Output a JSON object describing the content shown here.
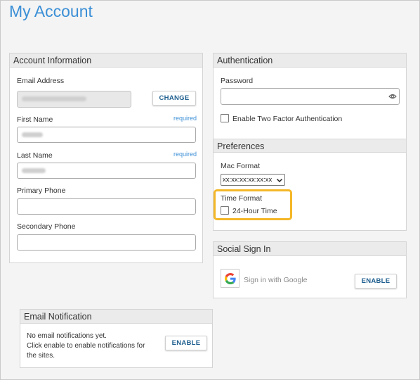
{
  "page": {
    "title": "My Account"
  },
  "account_info": {
    "header": "Account Information",
    "email_label": "Email Address",
    "change_label": "CHANGE",
    "first_name_label": "First Name",
    "last_name_label": "Last Name",
    "required_text": "required",
    "primary_phone_label": "Primary Phone",
    "secondary_phone_label": "Secondary Phone"
  },
  "authentication": {
    "header": "Authentication",
    "password_label": "Password",
    "two_factor_label": "Enable Two Factor Authentication"
  },
  "preferences": {
    "header": "Preferences",
    "mac_format_label": "Mac Format",
    "mac_format_value": "xx:xx:xx:xx:xx:xx",
    "time_format_label": "Time Format",
    "time_24h_label": "24-Hour Time",
    "highlight_color": "#f4b728"
  },
  "social": {
    "header": "Social Sign In",
    "google_label": "Sign in with Google",
    "enable_label": "ENABLE"
  },
  "email_notification": {
    "header": "Email Notification",
    "line1": "No email notifications yet.",
    "line2": "Click enable to enable notifications for",
    "line3": "the sites.",
    "enable_label": "ENABLE"
  },
  "colors": {
    "accent": "#3b8fd6",
    "button_text": "#1f5f8f"
  }
}
